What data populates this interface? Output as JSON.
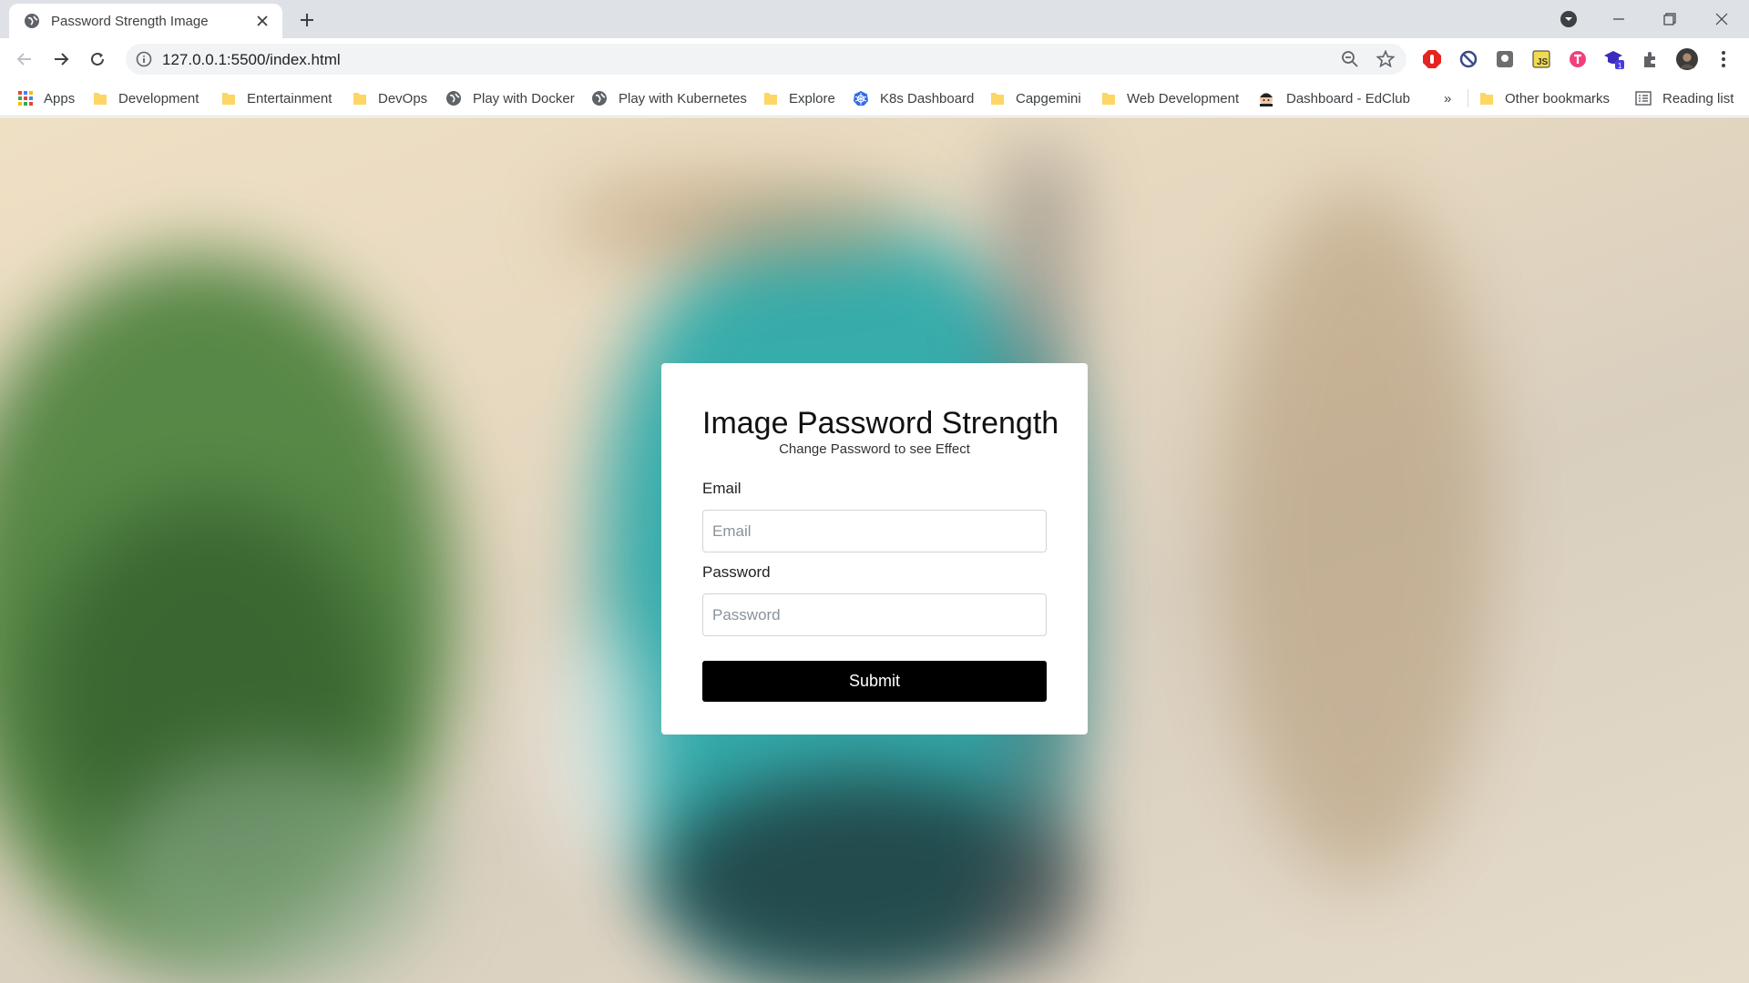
{
  "browser": {
    "tab_title": "Password Strength Image",
    "url": "127.0.0.1:5500/index.html",
    "accent": "#dee1e6"
  },
  "bookmarks": {
    "items": [
      {
        "label": "Apps",
        "icon": "apps-grid-icon"
      },
      {
        "label": "Development",
        "icon": "folder-icon"
      },
      {
        "label": "Entertainment",
        "icon": "folder-icon"
      },
      {
        "label": "DevOps",
        "icon": "folder-icon"
      },
      {
        "label": "Play with Docker",
        "icon": "globe-icon"
      },
      {
        "label": "Play with Kubernetes",
        "icon": "globe-icon"
      },
      {
        "label": "Explore",
        "icon": "folder-icon"
      },
      {
        "label": "K8s Dashboard",
        "icon": "kubernetes-icon"
      },
      {
        "label": "Capgemini",
        "icon": "folder-icon"
      },
      {
        "label": "Web Development",
        "icon": "folder-icon"
      },
      {
        "label": "Dashboard - EdClub",
        "icon": "edclub-icon"
      }
    ],
    "overflow": "»",
    "other": "Other bookmarks",
    "reading_list": "Reading list"
  },
  "form": {
    "title": "Image Password Strength",
    "subtitle": "Change Password to see Effect",
    "email_label": "Email",
    "email_placeholder": "Email",
    "password_label": "Password",
    "password_placeholder": "Password",
    "submit_label": "Submit",
    "submit_color": "#000000"
  }
}
